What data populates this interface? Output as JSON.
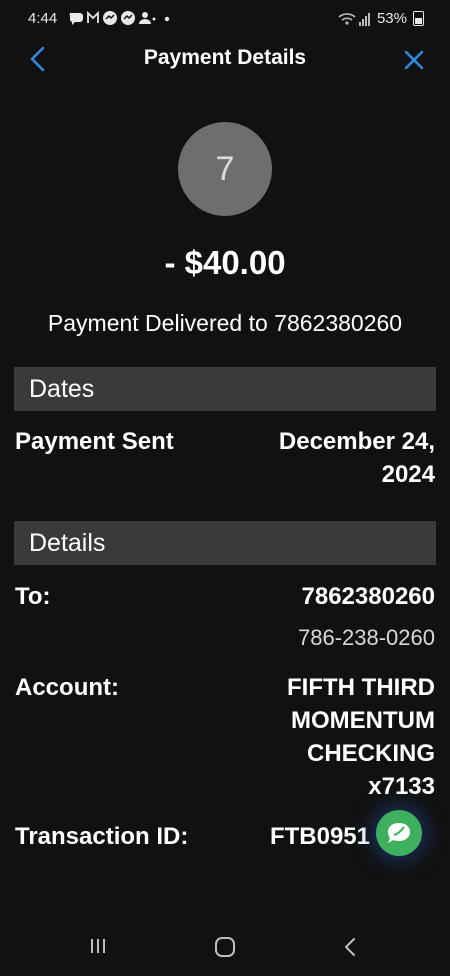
{
  "status_bar": {
    "time": "4:44",
    "notification_icons": "● M ● ● ♣ •",
    "battery": "53%",
    "signal_icon": "wifi-signal-icon"
  },
  "header": {
    "title": "Payment Details",
    "back_icon": "chevron-left-icon",
    "close_icon": "close-icon",
    "accent_color": "#2e8be6"
  },
  "payee": {
    "avatar_initial": "7",
    "amount": "- $40.00",
    "status": "Payment Delivered to 7862380260"
  },
  "dates_section": {
    "title": "Dates",
    "payment_sent_label": "Payment Sent",
    "payment_sent_line1": "December 24,",
    "payment_sent_line2": "2024"
  },
  "details_section": {
    "title": "Details",
    "to_label": "To:",
    "to_value": "7862380260",
    "to_formatted": "786-238-0260",
    "account_label": "Account:",
    "account_line1": "FIFTH THIRD",
    "account_line2": "MOMENTUM",
    "account_line3": "CHECKING",
    "account_line4": "x7133",
    "transaction_label": "Transaction ID:",
    "transaction_value": "FTB0951"
  },
  "chat_button": {
    "icon": "chat-bubble-icon",
    "color": "#3fb15e"
  }
}
